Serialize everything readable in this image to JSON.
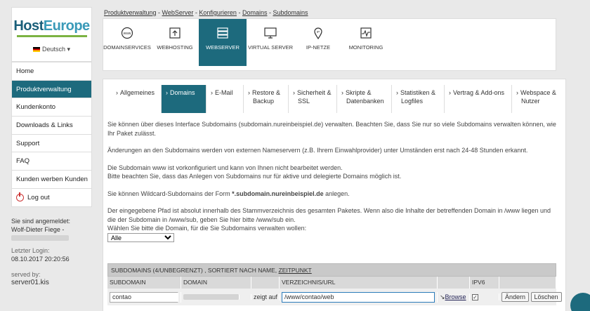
{
  "sidebar": {
    "logo_host": "Host",
    "logo_europe": "Europe",
    "language": "Deutsch ▾",
    "items": [
      {
        "label": "Home",
        "active": false
      },
      {
        "label": "Produktverwaltung",
        "active": true
      },
      {
        "label": "Kundenkonto",
        "active": false
      },
      {
        "label": "Downloads & Links",
        "active": false
      },
      {
        "label": "Support",
        "active": false
      },
      {
        "label": "FAQ",
        "active": false
      },
      {
        "label": "Kunden werben Kunden",
        "active": false
      }
    ],
    "logout": "Log out",
    "logged_in_label": "Sie sind angemeldet:",
    "logged_in_user": "Wolf-Dieter Fiege -",
    "last_login_label": "Letzter Login:",
    "last_login": "08.10.2017 20:20:56",
    "served_by_label": "served by:",
    "server": "server01.kis"
  },
  "breadcrumb": [
    "Produktverwaltung",
    "WebServer",
    "Konfigurieren",
    "Domains",
    "Subdomains"
  ],
  "topnav": [
    {
      "label": "DOMAINSERVICES",
      "icon": "globe-www-icon",
      "active": false
    },
    {
      "label": "WEBHOSTING",
      "icon": "upload-box-icon",
      "active": false
    },
    {
      "label": "WEBSERVER",
      "icon": "server-icon",
      "active": true
    },
    {
      "label": "VIRTUAL SERVER",
      "icon": "monitor-icon",
      "active": false
    },
    {
      "label": "IP-NETZE",
      "icon": "ip-pin-icon",
      "active": false
    },
    {
      "label": "MONITORING",
      "icon": "pulse-icon",
      "active": false
    }
  ],
  "subtabs": [
    {
      "line1": "Allgemeines",
      "line2": "",
      "active": false
    },
    {
      "line1": "Domains",
      "line2": "",
      "active": true
    },
    {
      "line1": "E-Mail",
      "line2": "",
      "active": false
    },
    {
      "line1": "Restore &",
      "line2": "Backup",
      "active": false
    },
    {
      "line1": "Sicherheit &",
      "line2": "SSL",
      "active": false
    },
    {
      "line1": "Skripte &",
      "line2": "Datenbanken",
      "active": false
    },
    {
      "line1": "Statistiken &",
      "line2": "Logfiles",
      "active": false
    },
    {
      "line1": "Vertrag & Add-ons",
      "line2": "",
      "active": false
    },
    {
      "line1": "Webspace &",
      "line2": "Nutzer",
      "active": false
    }
  ],
  "content": {
    "p1": "Sie können über dieses Interface Subdomains (subdomain.nureinbeispiel.de) verwalten. Beachten Sie, dass Sie nur so viele Subdomains verwalten können, wie Ihr Paket zulässt.",
    "p2": "Änderungen an den Subdomains werden von externen Nameservern (z.B. Ihrem Einwahlprovider) unter Umständen erst nach 24-48 Stunden erkannt.",
    "p3a": "Die Subdomain www ist vorkonfiguriert und kann von Ihnen nicht bearbeitet werden.",
    "p3b": "Bitte beachten Sie, dass das Anlegen von Subdomains nur für aktive und delegierte Domains möglich ist.",
    "p4_pre": "Sie können Wildcard-Subdomains der Form ",
    "p4_bold": "*.subdomain.nureinbeispiel.de",
    "p4_post": " anlegen.",
    "p5a": "Der eingegebene Pfad ist absolut innerhalb des Stammverzeichnis des gesamten Paketes. Wenn also die Inhalte der betreffenden Domain in /www liegen und die der Subdomain in /www/sub, geben Sie hier bitte /www/sub ein.",
    "p5b": "Wählen Sie bitte die Domain, für die Sie Subdomains verwalten wollen:",
    "select_value": "Alle"
  },
  "table": {
    "caption_pre": "SUBDOMAINS (4/UNBEGRENZT) , SORTIERT NACH NAME, ",
    "caption_link": "ZEITPUNKT",
    "headers": [
      "SUBDOMAIN",
      "DOMAIN",
      "",
      "VERZEICHNIS/URL",
      "",
      "IPV6",
      ""
    ],
    "row": {
      "subdomain": "contao",
      "arrow": "zeigt auf",
      "path": "/www/contao/web",
      "browse": "Browse",
      "ipv6_checked": "✓",
      "edit": "Ändern",
      "delete": "Löschen"
    }
  },
  "colors": {
    "accent": "#1d6a7d",
    "logo_green": "#7cb342"
  }
}
